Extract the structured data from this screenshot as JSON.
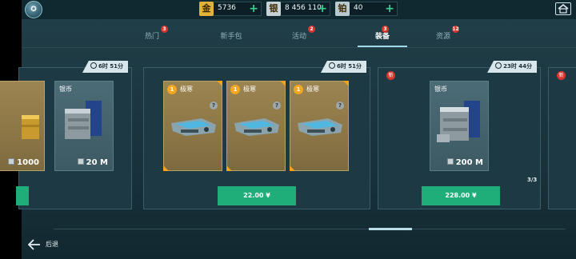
{
  "topbar": {
    "resources": [
      {
        "icon_char": "金",
        "icon": "gold-icon",
        "color": "#e0b23a",
        "value": "5736"
      },
      {
        "icon_char": "银",
        "icon": "silver-icon",
        "color": "#c7d2d6",
        "value": "8 456 110"
      },
      {
        "icon_char": "铂",
        "icon": "platinum-icon",
        "color": "#b9c9d0",
        "value": "40"
      }
    ],
    "add_symbol": "+"
  },
  "tabs": [
    {
      "label": "热门",
      "badge": "3"
    },
    {
      "label": "新手包",
      "badge": ""
    },
    {
      "label": "活动",
      "badge": "2"
    },
    {
      "label": "装备",
      "badge": "3",
      "active": true
    },
    {
      "label": "资源",
      "badge": "12"
    }
  ],
  "panels": {
    "left": {
      "timer": "6时 51分",
      "cards": [
        {
          "label": "",
          "amount": "1000"
        },
        {
          "label": "银币",
          "amount": "20 M"
        }
      ]
    },
    "middle": {
      "timer": "6时 51分",
      "cards": [
        {
          "level": "1",
          "label": "极寒",
          "help": "?"
        },
        {
          "level": "1",
          "label": "极寒",
          "help": "?"
        },
        {
          "level": "1",
          "label": "极寒",
          "help": "?"
        }
      ],
      "price": "22.00 ¥"
    },
    "right": {
      "new_badge": "新",
      "timer": "23时 44分",
      "card": {
        "label": "银币",
        "amount": "200 M"
      },
      "stock": "3/3",
      "price": "228.00 ¥"
    },
    "far_right": {
      "new_badge": "新"
    }
  },
  "footer": {
    "back_label": "后退"
  },
  "colors": {
    "accent_green": "#1fae79",
    "badge_red": "#d8352f",
    "gold_card": "#8c7646"
  }
}
